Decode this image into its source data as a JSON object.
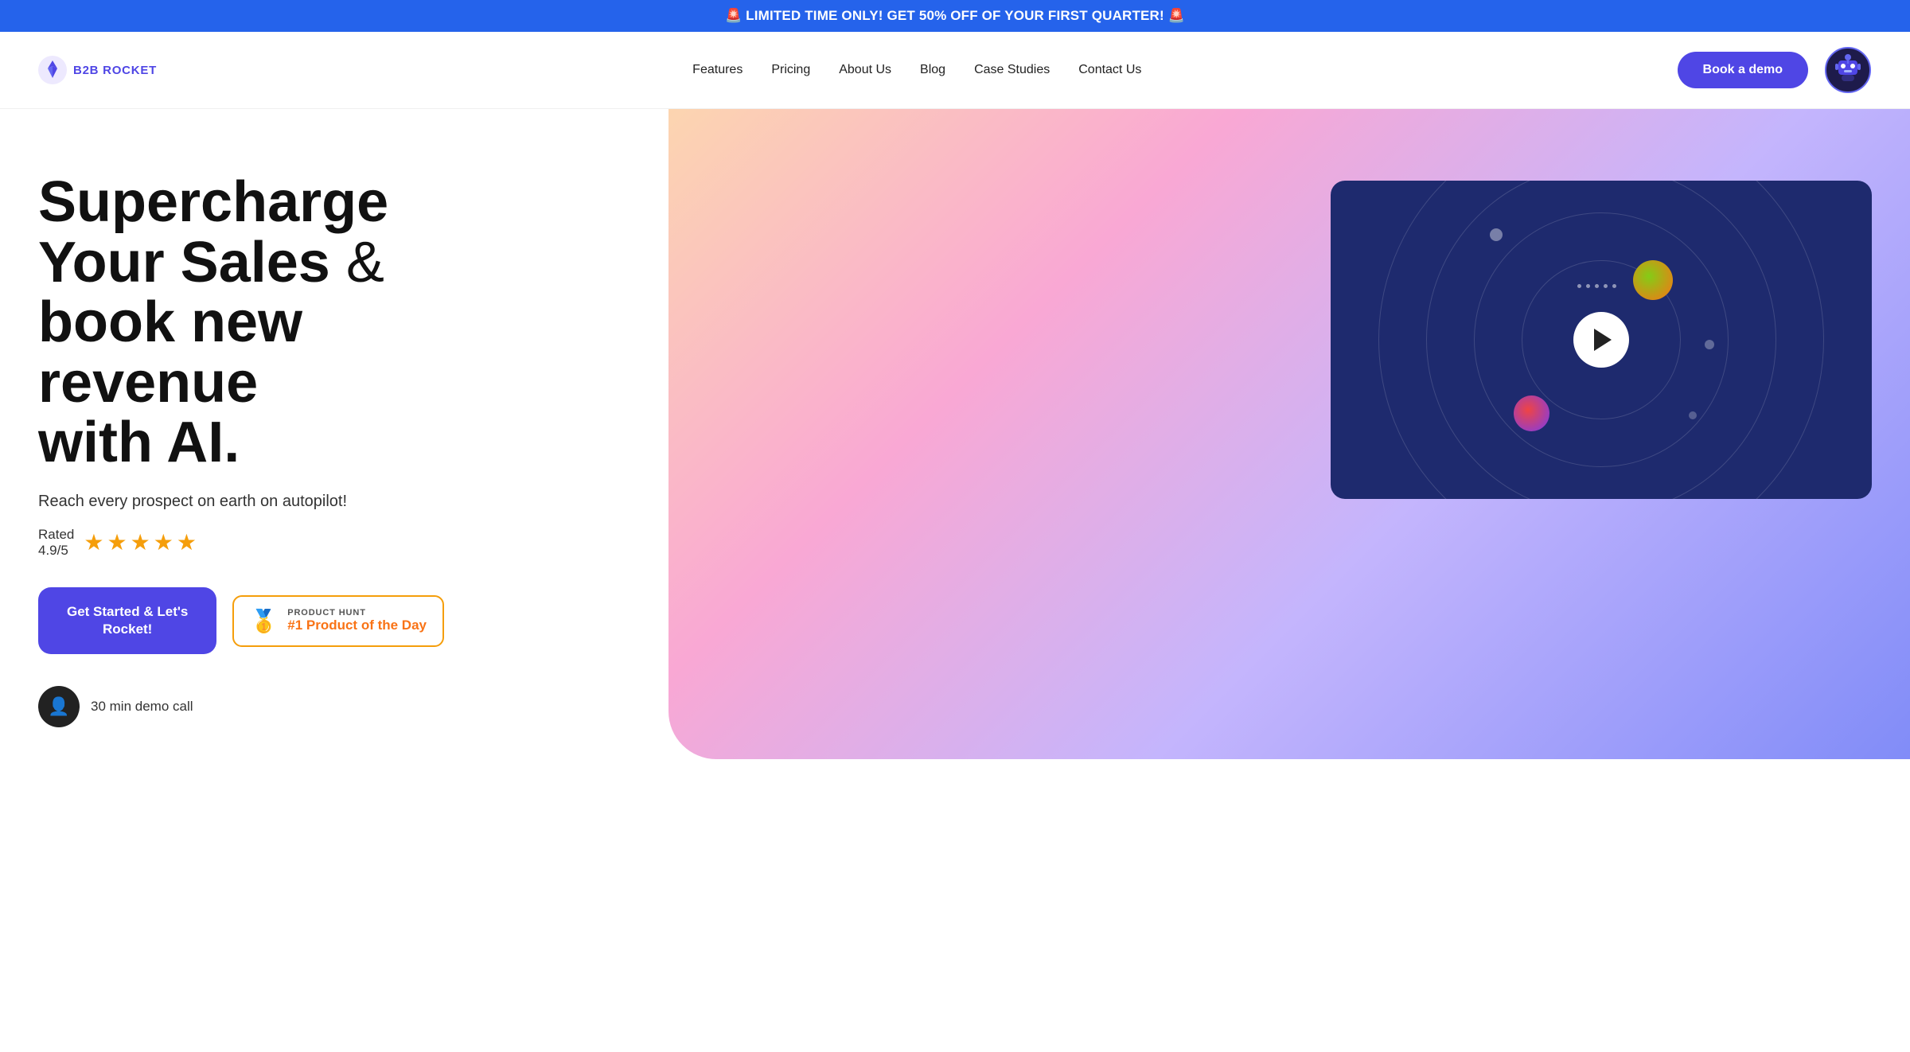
{
  "banner": {
    "text": "🚨 LIMITED TIME ONLY! GET 50% OFF OF YOUR FIRST QUARTER! 🚨"
  },
  "nav": {
    "logo_text": "B2B ROCKET",
    "links": [
      {
        "label": "Features",
        "id": "features"
      },
      {
        "label": "Pricing",
        "id": "pricing"
      },
      {
        "label": "About Us",
        "id": "about"
      },
      {
        "label": "Blog",
        "id": "blog"
      },
      {
        "label": "Case Studies",
        "id": "case-studies"
      },
      {
        "label": "Contact Us",
        "id": "contact"
      }
    ],
    "cta": "Book a demo"
  },
  "hero": {
    "title_line1": "Supercharge",
    "title_line2": "Your Sales",
    "title_ampersand": " &",
    "title_line3": "book new revenue",
    "title_line4": "with AI.",
    "subtitle": "Reach every prospect on earth on autopilot!",
    "rating_label": "Rated",
    "rating_value": "4.9/5",
    "stars": 4.9,
    "cta_button": "Get Started & Let's\nRocket!",
    "product_hunt_label": "PRODUCT HUNT",
    "product_hunt_title": "#1 Product of the Day",
    "demo_row_text": "30 min demo call"
  }
}
